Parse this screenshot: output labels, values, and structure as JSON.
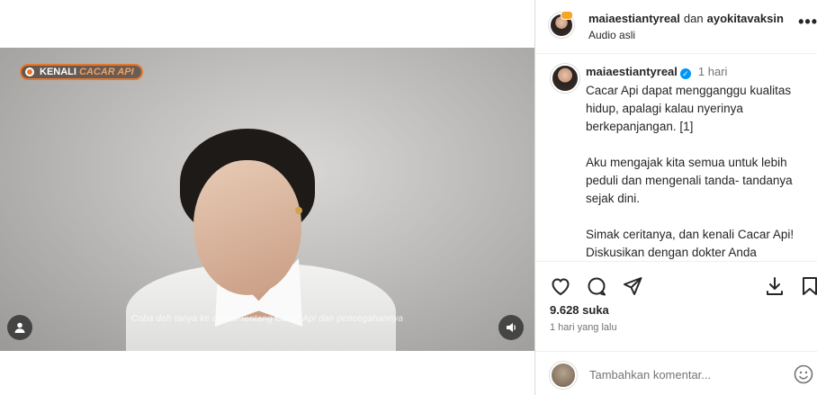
{
  "video": {
    "badge_main": "KENALI",
    "badge_accent": "CACAR API",
    "subtitle": "Coba deh tanya ke dokter tentang Cacar Api dan pencegahannya"
  },
  "header": {
    "user1": "maiaestiantyreal",
    "and": "dan",
    "user2": "ayokitavaksin",
    "audio": "Audio asli",
    "more": "•••"
  },
  "caption": {
    "username": "maiaestiantyreal",
    "time": "1 hari",
    "paragraphs": [
      "Cacar Api dapat mengganggu kualitas hidup, apalagi kalau nyerinya berkepanjangan. [1]",
      "Aku mengajak kita semua untuk lebih peduli dan mengenali tanda- tandanya sejak dini.",
      "Simak ceritanya, dan kenali Cacar Api! Diskusikan dengan dokter Anda mengenai Cacar Api dan"
    ]
  },
  "stats": {
    "likes": "9.628 suka",
    "posted": "1 hari yang lalu"
  },
  "comment": {
    "placeholder": "Tambahkan komentar..."
  },
  "icons": {
    "like": "heart-icon",
    "comment": "comment-icon",
    "share": "share-icon",
    "save": "download-icon",
    "bookmark": "bookmark-icon",
    "emoji": "emoji-icon",
    "user": "user-icon",
    "sound": "sound-icon"
  }
}
